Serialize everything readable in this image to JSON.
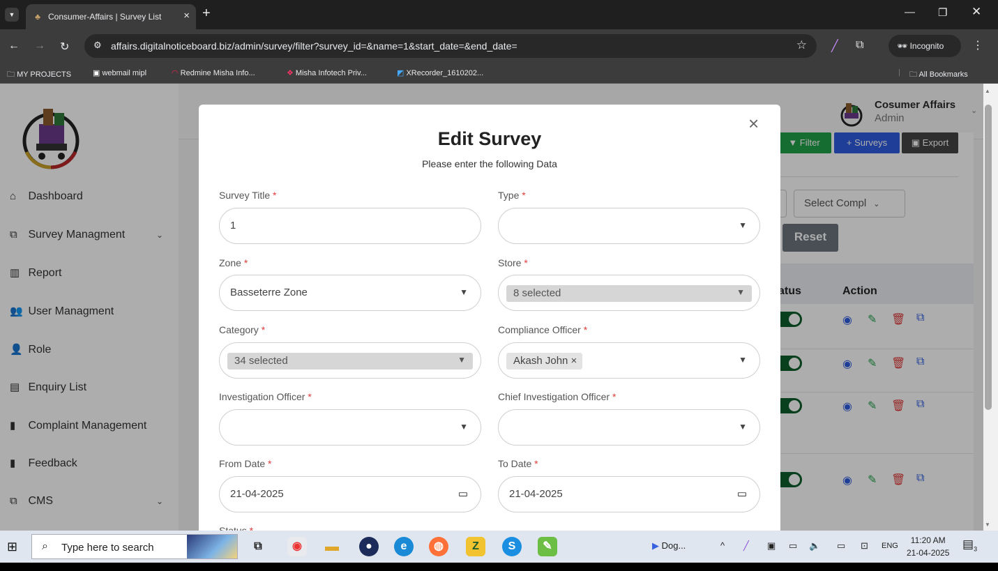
{
  "browser": {
    "tab_title": "Consumer-Affairs | Survey List",
    "url": "affairs.digitalnoticeboard.biz/admin/survey/filter?survey_id=&name=1&start_date=&end_date=",
    "incognito_label": "Incognito",
    "bookmarks": [
      "MY PROJECTS",
      "webmail mipl",
      "Redmine Misha Info...",
      "Misha Infotech Priv...",
      "XRecorder_1610202..."
    ],
    "all_bookmarks": "All Bookmarks"
  },
  "sidebar": {
    "items": [
      {
        "label": "Dashboard",
        "icon": "home-icon"
      },
      {
        "label": "Survey Managment",
        "icon": "copy-icon",
        "has_submenu": true
      },
      {
        "label": "Report",
        "icon": "chart-icon"
      },
      {
        "label": "User Managment",
        "icon": "users-icon"
      },
      {
        "label": "Role",
        "icon": "user-icon"
      },
      {
        "label": "Enquiry List",
        "icon": "id-card-icon"
      },
      {
        "label": "Complaint Management",
        "icon": "file-icon"
      },
      {
        "label": "Feedback",
        "icon": "clipboard-icon"
      },
      {
        "label": "CMS",
        "icon": "copy-icon",
        "has_submenu": true
      }
    ]
  },
  "header": {
    "profile_name": "Cosumer Affairs",
    "profile_role": "Admin"
  },
  "background": {
    "filter_button": "Filter",
    "surveys_button": "+ Surveys",
    "export_button": "Export",
    "select_complaint": "Select Compl",
    "reset_button": "Reset",
    "col_status": "atus",
    "col_action": "Action"
  },
  "modal": {
    "title": "Edit Survey",
    "subtitle": "Please enter the following Data",
    "required_mark": "*",
    "fields": {
      "survey_title": {
        "label": "Survey Title",
        "value": "1"
      },
      "type": {
        "label": "Type",
        "value": ""
      },
      "zone": {
        "label": "Zone",
        "value": "Basseterre Zone"
      },
      "store": {
        "label": "Store",
        "value": "8 selected"
      },
      "category": {
        "label": "Category",
        "value": "34 selected"
      },
      "compliance_officer": {
        "label": "Compliance Officer",
        "value": "Akash John ×"
      },
      "investigation_officer": {
        "label": "Investigation Officer",
        "value": ""
      },
      "chief_investigation_officer": {
        "label": "Chief Investigation Officer",
        "value": ""
      },
      "from_date": {
        "label": "From Date",
        "value": "21-04-2025"
      },
      "to_date": {
        "label": "To Date",
        "value": "21-04-2025"
      },
      "status": {
        "label": "Status"
      }
    }
  },
  "taskbar": {
    "search_placeholder": "Type here to search",
    "running_app": "Dog...",
    "language": "ENG",
    "time": "11:20 AM",
    "date": "21-04-2025",
    "notification_count": "3"
  },
  "colors": {
    "primary_green": "#21a14a",
    "primary_blue": "#2f5ce0",
    "toggle_green": "#0c5d2a",
    "required_red": "#e23b3b"
  }
}
